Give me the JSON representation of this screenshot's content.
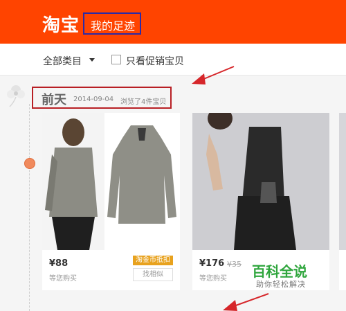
{
  "header": {
    "logo": "淘宝",
    "title": "我的足迹"
  },
  "filters": {
    "category": "全部类目",
    "promo_label": "只看促销宝贝",
    "promo_checked": false
  },
  "timeline": {
    "day": "前天",
    "date": "2014-09-04",
    "viewed": "浏览了4件宝贝"
  },
  "items": [
    {
      "price": "¥88",
      "note": "等您购买",
      "tag": "淘金币抵扣",
      "similar": "找相似"
    },
    {
      "price": "¥176",
      "old_price": "¥35",
      "note": "等您购买"
    }
  ],
  "watermark": {
    "title": "百科全说",
    "subtitle": "助你轻松解决"
  },
  "colors": {
    "brand": "#ff4400",
    "annotation_red": "#d6262a",
    "annotation_blue": "#2a2aa8",
    "watermark_green": "#2fa63d"
  }
}
